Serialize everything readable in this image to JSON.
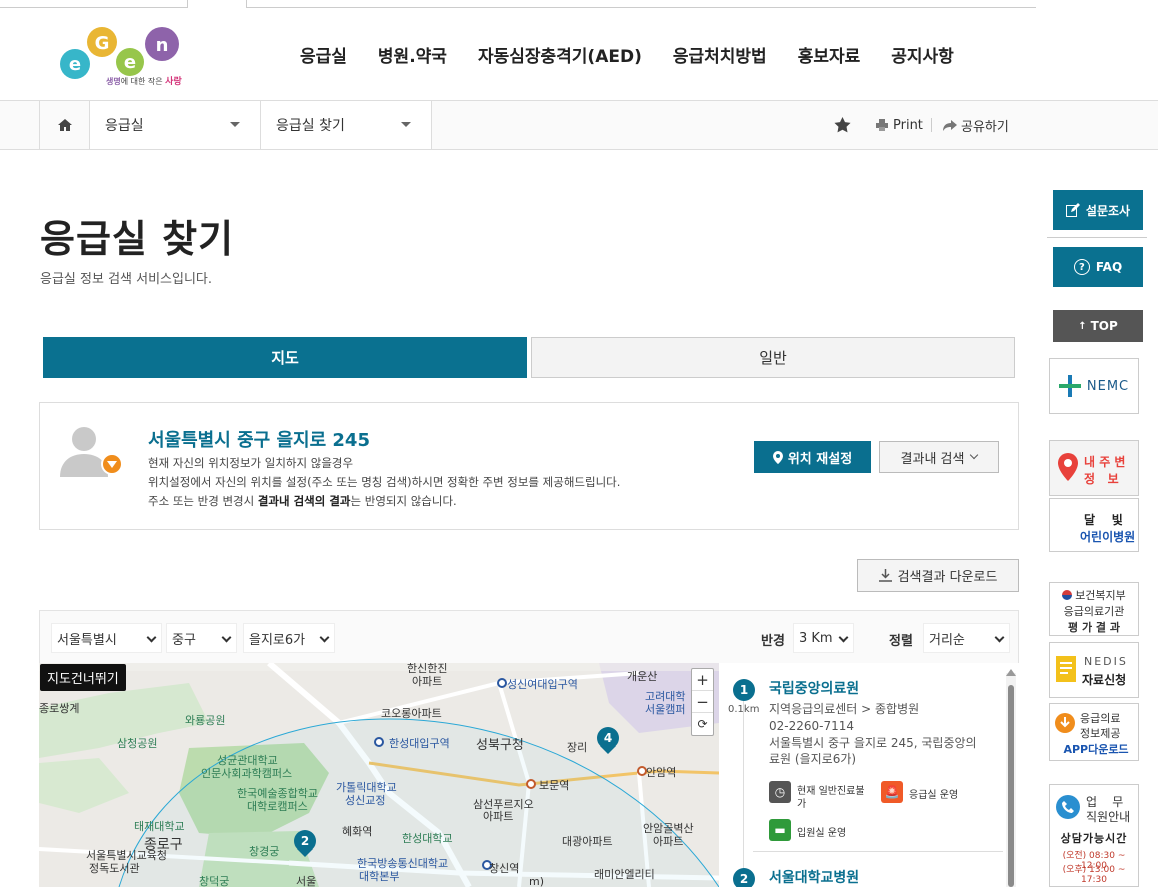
{
  "logo": {
    "text": "EGEN",
    "tagline_1": "생명",
    "tagline_2": "에 대한 작은 ",
    "tagline_3": "사랑"
  },
  "gnb": [
    "응급실",
    "병원.약국",
    "자동심장충격기(AED)",
    "응급처치방법",
    "홍보자료",
    "공지사항"
  ],
  "breadcrumb": {
    "level1": "응급실",
    "level2": "응급실 찾기"
  },
  "util": {
    "print": "Print",
    "share": "공유하기"
  },
  "page": {
    "title": "응급실 찾기",
    "subtitle": "응급실 정보 검색 서비스입니다."
  },
  "tabs": {
    "map": "지도",
    "general": "일반"
  },
  "location": {
    "address": "서울특별시 중구 을지로 245",
    "line1": "현재 자신의 위치정보가 일치하지 않을경우",
    "line2": "위치설정에서 자신의 위치를 설정(주소 또는 명칭 검색)하시면 정확한 주변 정보를 제공해드립니다.",
    "line3_a": "주소 또는 반경 변경시 ",
    "line3_b": "결과내 검색의 결과",
    "line3_c": "는 반영되지 않습니다.",
    "reset_btn": "위치 재설정",
    "within_btn": "결과내 검색"
  },
  "download_btn": "검색결과 다운로드",
  "filters": {
    "city": "서울특별시",
    "district": "중구",
    "street": "을지로6가",
    "radius_label": "반경",
    "radius": "3 Km",
    "sort_label": "정렬",
    "sort": "거리순"
  },
  "map": {
    "skip": "지도건너뛰기",
    "labels": [
      "한신한진",
      "아파트",
      "성신여대입구역",
      "개운산",
      "고려대학",
      "서울캠퍼",
      "와룡공원",
      "코오롱아파트",
      "삼청공원",
      "한성대입구역",
      "성북구청",
      "장리",
      "성균관대학교",
      "인문사회과학캠퍼스",
      "가톨릭대학교",
      "성신교정",
      "보문역",
      "안암역",
      "한국예술종합학교",
      "대학로캠퍼스",
      "삼선푸르지오",
      "아파트",
      "태재대학교",
      "혜화역",
      "한성대학교",
      "대광아파트",
      "안암골벽산",
      "아파트",
      "종로구",
      "서울특별시교육청",
      "정독도서관",
      "창경궁",
      "한국방송통신대학교",
      "대학본부",
      "창신역",
      "래미안엘리티",
      "창덕궁",
      "서울",
      "종로쌍계",
      "m)"
    ],
    "pins": [
      "2",
      "4"
    ]
  },
  "results": [
    {
      "num": "1",
      "dist": "0.1km",
      "name": "국립중앙의료원",
      "type": "지역응급의료센터 > 종합병원",
      "phone": "02-2260-7114",
      "addr1": "서울특별시 중구 을지로 245, 국립중앙의",
      "addr2": "료원 (을지로6가)",
      "status1a": "현재 일반진료불",
      "status1b": "가",
      "status2": "응급실 운영",
      "status3": "입원실 운영"
    },
    {
      "num": "2",
      "name": "서울대학교병원"
    }
  ],
  "quick": {
    "survey": "설문조사",
    "faq": "FAQ",
    "top": "TOP",
    "nemc": "NEMC",
    "nearby1": "내 주 변",
    "nearby2": "정   보",
    "moon1": "달    빛",
    "moon2": "어린이병원",
    "mohw1": "보건복지부",
    "mohw2": "응급의료기관",
    "mohw3": "평 가 결 과",
    "nedis1": "NEDIS",
    "nedis2": "자료신청",
    "app1": "응급의료",
    "app2": "정보제공",
    "app3": "APP다운로드",
    "phone1": "업    무",
    "phone2": "직원안내",
    "hours": "상담가능시간",
    "am": "(오전) 08:30 ~ 12:00",
    "pm": "(오후) 13:00 ~ 17:30"
  }
}
